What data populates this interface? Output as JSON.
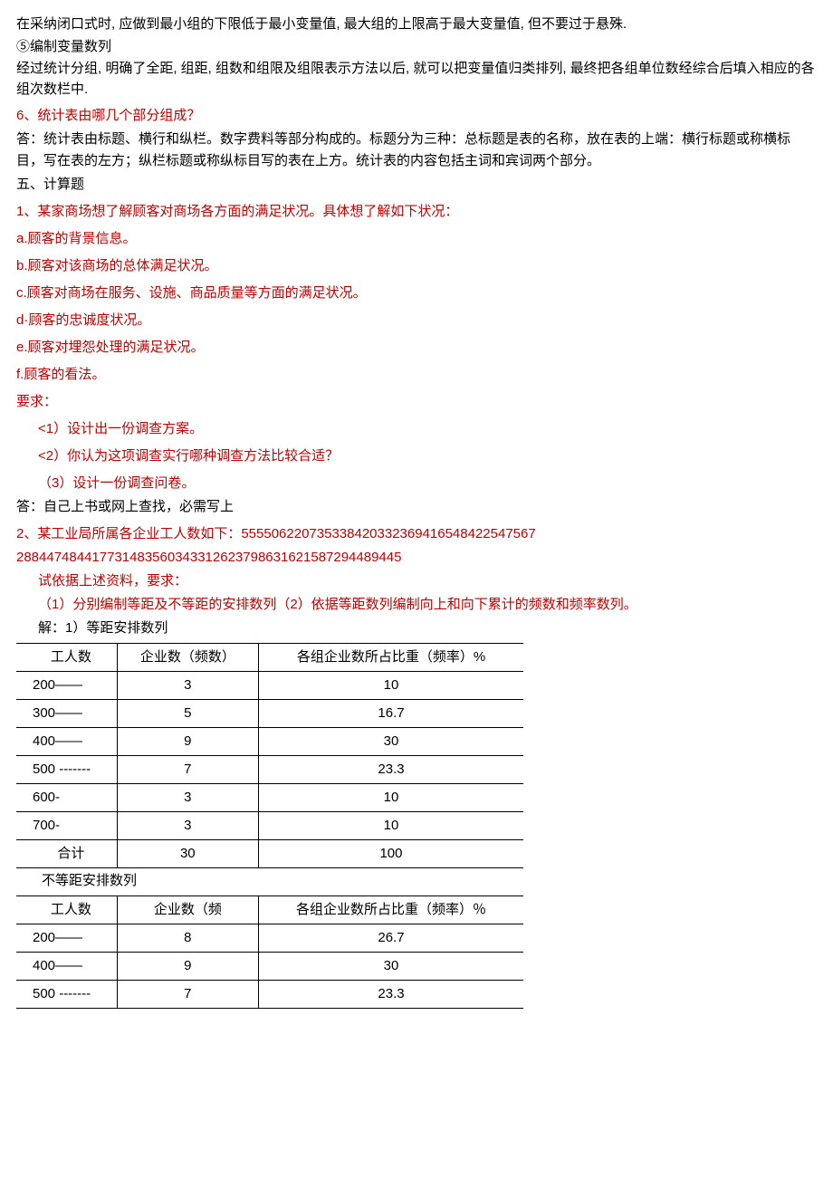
{
  "para1": "在采纳闭口式时, 应做到最小组的下限低于最小变量值, 最大组的上限高于最大变量值, 但不要过于悬殊.",
  "para2": "⑤编制变量数列",
  "para3": "经过统计分组, 明确了全距, 组距, 组数和组限及组限表示方法以后, 就可以把变量值归类排列, 最终把各组单位数经综合后填入相应的各组次数栏中.",
  "q6": "6、统计表由哪几个部分组成？",
  "a6": "答：统计表由标题、横行和纵栏。数字费料等部分构成的。标题分为三种：总标题是表的名称，放在表的上端：横行标题或称横标目，写在表的左方；纵栏标题或称纵标目写的表在上方。统计表的内容包括主词和宾词两个部分。",
  "sec5": "五、计算题",
  "q1_intro": "1、某家商场想了解顾客对商场各方面的满足状况。具体想了解如下状况：",
  "q1_a": "a.顾客的背景信息。",
  "q1_b": "b.顾客对该商场的总体满足状况。",
  "q1_c": "c.顾客对商场在服务、设施、商品质量等方面的满足状况。",
  "q1_d": "d·顾客的忠诚度状况。",
  "q1_e": "e.顾客对埋怨处理的满足状况。",
  "q1_f": "f.顾客的看法。",
  "q1_req": "要求：",
  "q1_r1": "<1）设计出一份调查方案。",
  "q1_r2": "<2）你认为这项调查实行哪种调查方法比较合适？",
  "q1_r3": "（3）设计一份调查问卷。",
  "q1_ans": "答：自己上书或网上查找，必需写上",
  "q2_l1": "2、某工业局所属各企业工人数如下：555506220735338420332369416548422547567",
  "q2_l2": "288447484417731483560343312623798631621587294489445",
  "q2_req": "试依据上述资料，要求：",
  "q2_sub": "（1）分别编制等距及不等距的安排数列（2）依据等距数列编制向上和向下累计的频数和频率数列。",
  "q2_sol": "解：1）等距安排数列",
  "t1": {
    "h1": "工人数",
    "h2": "企业数（频数）",
    "h3": "各组企业数所占比重（频率）%",
    "rows": [
      {
        "c1": "200——",
        "c2": "3",
        "c3": "10"
      },
      {
        "c1": "300——",
        "c2": "5",
        "c3": "16.7"
      },
      {
        "c1": "400——",
        "c2": "9",
        "c3": "30"
      },
      {
        "c1": "500 -------",
        "c2": "7",
        "c3": "23.3"
      },
      {
        "c1": "600-",
        "c2": "3",
        "c3": "10"
      },
      {
        "c1": "700-",
        "c2": "3",
        "c3": "10"
      },
      {
        "c1": "合计",
        "c2": "30",
        "c3": "100"
      }
    ]
  },
  "t2_caption": "不等距安排数列",
  "t2": {
    "h1": "工人数",
    "h2": "企业数（频",
    "h3": "各组企业数所占比重（频率）％",
    "rows": [
      {
        "c1": "200——",
        "c2": "8",
        "c3": "26.7"
      },
      {
        "c1": "400——",
        "c2": "9",
        "c3": "30"
      },
      {
        "c1": "500 -------",
        "c2": "7",
        "c3": "23.3"
      }
    ]
  }
}
